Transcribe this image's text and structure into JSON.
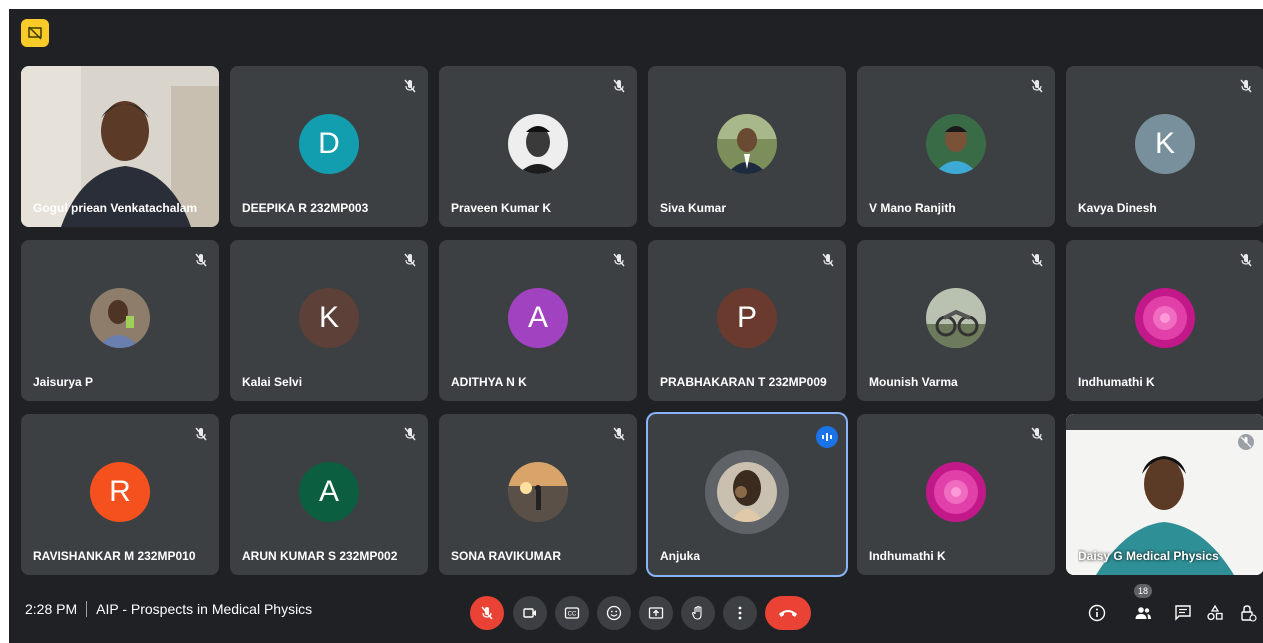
{
  "meeting": {
    "time": "2:28 PM",
    "title": "AIP - Prospects in Medical Physics"
  },
  "participant_count": "18",
  "participants": [
    {
      "name": "Gogul priean Venkatachalam",
      "type": "video",
      "muted": false
    },
    {
      "name": "DEEPIKA R 232MP003",
      "type": "initial",
      "initial": "D",
      "color": "#129eaf",
      "muted": true
    },
    {
      "name": "Praveen Kumar K",
      "type": "photo",
      "muted": true
    },
    {
      "name": "Siva Kumar",
      "type": "photo",
      "muted": false
    },
    {
      "name": "V Mano Ranjith",
      "type": "photo",
      "muted": true
    },
    {
      "name": "Kavya Dinesh",
      "type": "initial",
      "initial": "K",
      "color": "#78909c",
      "muted": true
    },
    {
      "name": "Jaisurya P",
      "type": "photo",
      "muted": true
    },
    {
      "name": "Kalai Selvi",
      "type": "initial",
      "initial": "K",
      "color": "#5d4037",
      "muted": true
    },
    {
      "name": "ADITHYA N K",
      "type": "initial",
      "initial": "A",
      "color": "#a142c1",
      "muted": true
    },
    {
      "name": "PRABHAKARAN T 232MP009",
      "type": "initial",
      "initial": "P",
      "color": "#6b3a2e",
      "muted": true
    },
    {
      "name": "Mounish Varma",
      "type": "photo",
      "muted": true
    },
    {
      "name": "Indhumathi K",
      "type": "photo",
      "muted": true
    },
    {
      "name": "RAVISHANKAR M 232MP010",
      "type": "initial",
      "initial": "R",
      "color": "#f4511e",
      "muted": true
    },
    {
      "name": "ARUN KUMAR S 232MP002",
      "type": "initial",
      "initial": "A",
      "color": "#0b5e3f",
      "muted": true
    },
    {
      "name": "SONA RAVIKUMAR",
      "type": "photo",
      "muted": true
    },
    {
      "name": "Anjuka",
      "type": "photo",
      "speaking": true,
      "muted": false
    },
    {
      "name": "Indhumathi K",
      "type": "photo",
      "muted": true
    },
    {
      "name": "Daisy G Medical Physics",
      "type": "video",
      "muted": true
    }
  ],
  "icons": [
    "mic-off-icon",
    "camera-icon",
    "captions-icon",
    "emoji-icon",
    "present-icon",
    "raise-hand-icon",
    "more-icon",
    "hang-up-icon",
    "info-icon",
    "people-icon",
    "chat-icon",
    "activities-icon",
    "host-controls-icon"
  ]
}
